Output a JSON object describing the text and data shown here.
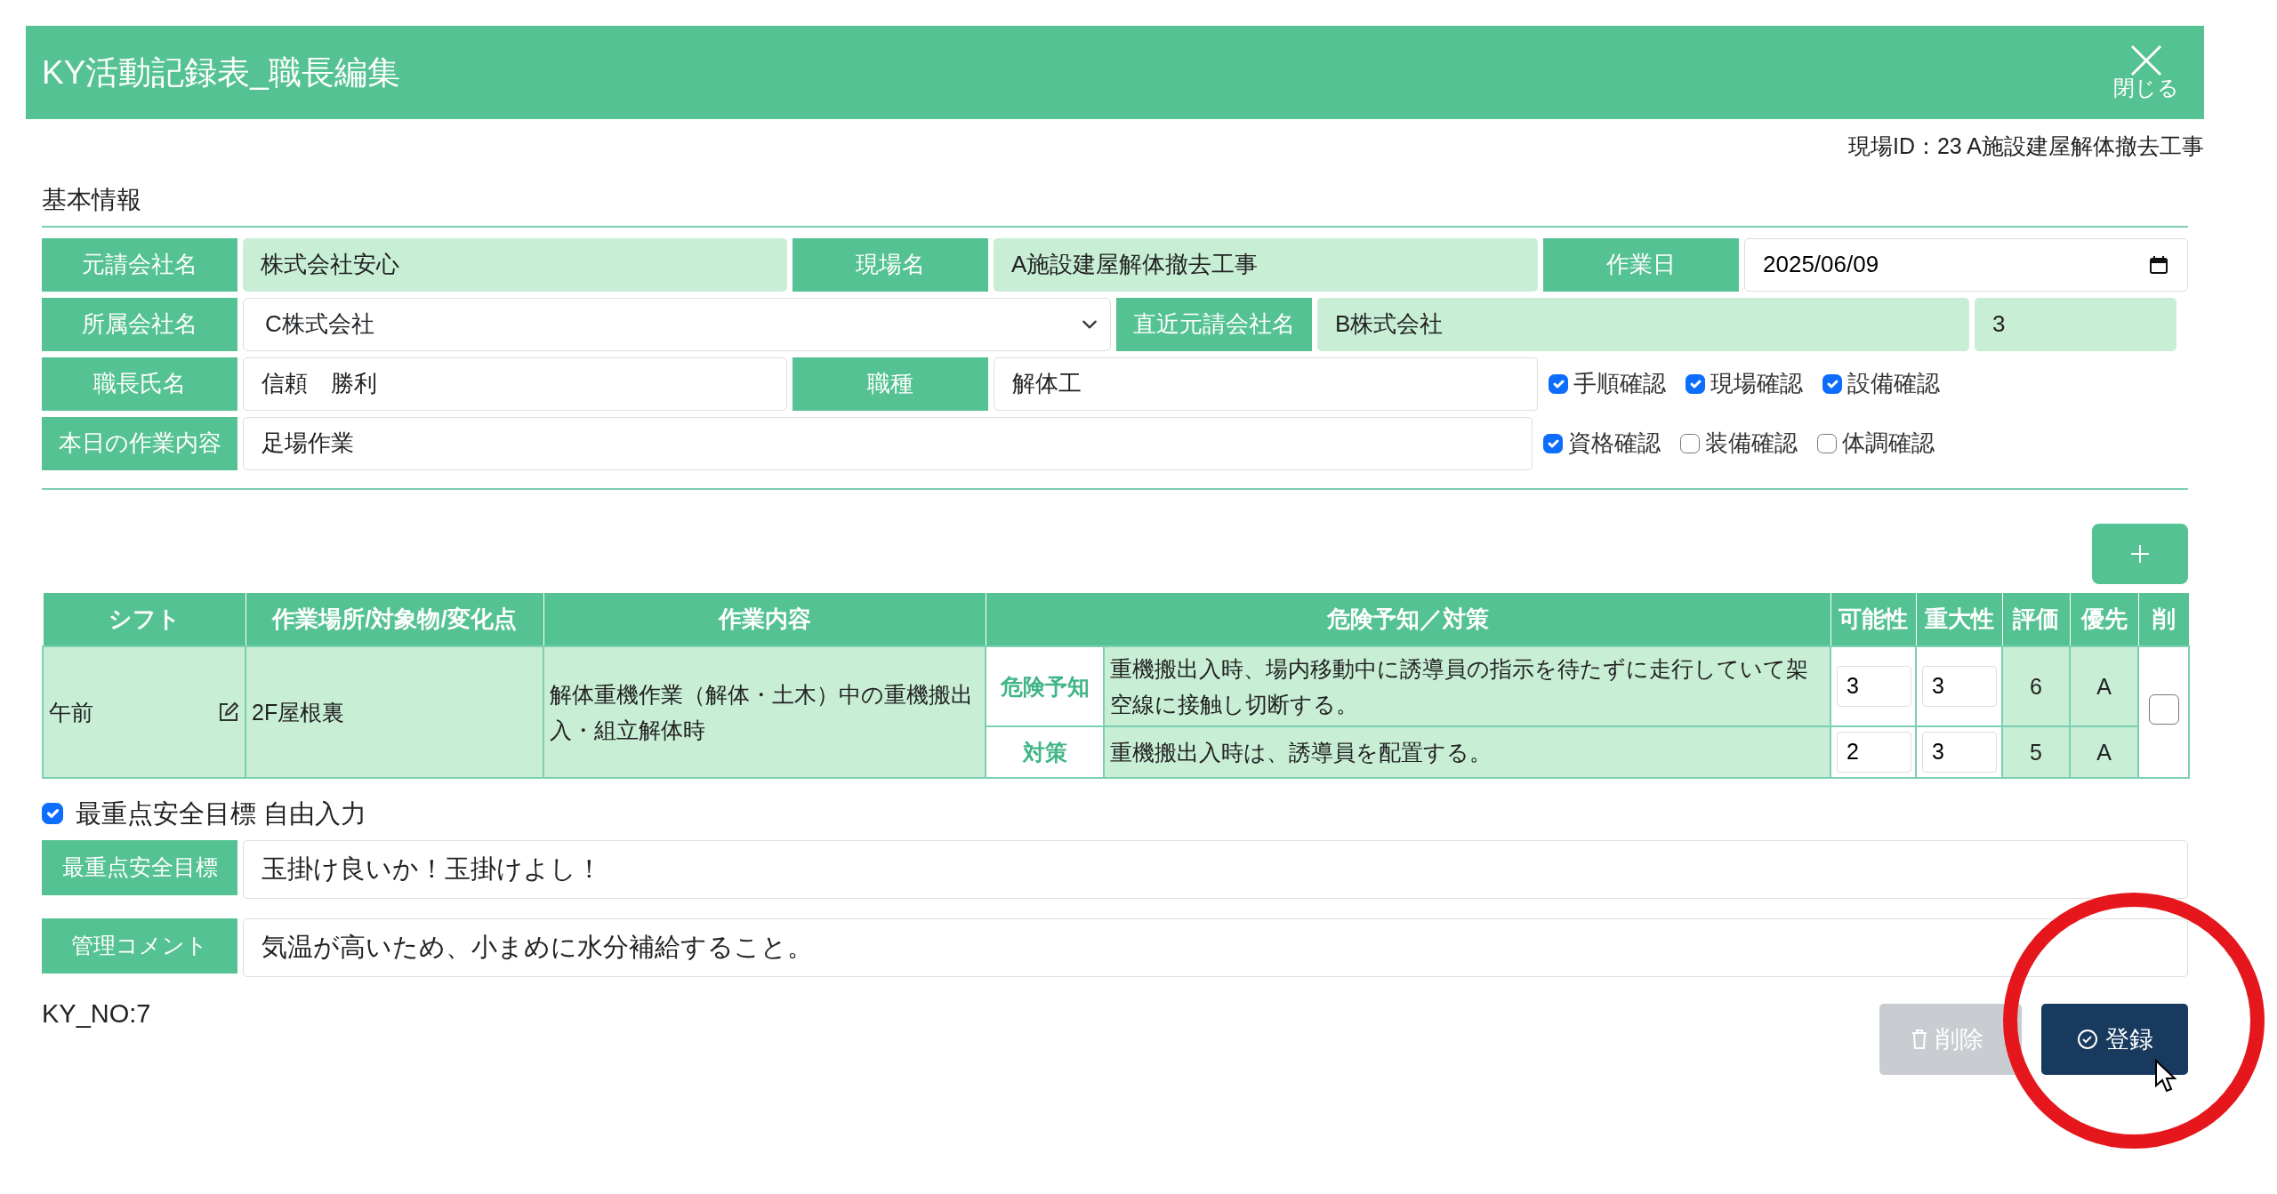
{
  "window": {
    "title": "KY活動記録表_職長編集",
    "close_label": "閉じる"
  },
  "site_id": "現場ID：23 A施設建屋解体撤去工事",
  "section_title": "基本情報",
  "form_rows": [
    [
      {
        "kind": "label",
        "text": "元請会社名"
      },
      {
        "kind": "readonly",
        "value": "株式会社安心"
      },
      {
        "kind": "label",
        "text": "現場名"
      },
      {
        "kind": "readonly",
        "value": "A施設建屋解体撤去工事"
      },
      {
        "kind": "label",
        "text": "作業日"
      },
      {
        "kind": "date",
        "value": "2025/06/09"
      }
    ],
    [
      {
        "kind": "label",
        "text": "所属会社名"
      },
      {
        "kind": "select",
        "value": "C株式会社"
      },
      {
        "kind": "label",
        "text": "直近元請会社名"
      },
      {
        "kind": "readonly",
        "value": "B株式会社"
      },
      {
        "kind": "readonly",
        "value": "3"
      }
    ],
    [
      {
        "kind": "label",
        "text": "職長氏名"
      },
      {
        "kind": "input",
        "value": "信頼　勝利"
      },
      {
        "kind": "label",
        "text": "職種"
      },
      {
        "kind": "input",
        "value": "解体工"
      },
      {
        "kind": "checks",
        "items": [
          {
            "label": "手順確認",
            "checked": true
          },
          {
            "label": "現場確認",
            "checked": true
          },
          {
            "label": "設備確認",
            "checked": true
          }
        ]
      }
    ],
    [
      {
        "kind": "label",
        "text": "本日の作業内容"
      },
      {
        "kind": "input",
        "value": "足場作業"
      },
      {
        "kind": "checks",
        "items": [
          {
            "label": "資格確認",
            "checked": true
          },
          {
            "label": "装備確認",
            "checked": false
          },
          {
            "label": "体調確認",
            "checked": false
          }
        ]
      }
    ]
  ],
  "table": {
    "columns": [
      "シフト",
      "作業場所/対象物/変化点",
      "作業内容",
      "危険予知／対策",
      "可能性",
      "重大性",
      "評価",
      "優先",
      "削"
    ],
    "rows": [
      {
        "shift": "午前",
        "place": "2F屋根裏",
        "work": "解体重機作業（解体・土木）中の重機搬出入・組立解体時",
        "delete_checked": false,
        "items": [
          {
            "tag": "危険予知",
            "text": "重機搬出入時、場内移動中に誘導員の指示を待たずに走行していて架空線に接触し切断する。",
            "likelihood": "3",
            "severity": "3",
            "score": "6",
            "priority": "A"
          },
          {
            "tag": "対策",
            "text": "重機搬出入時は、誘導員を配置する。",
            "likelihood": "2",
            "severity": "3",
            "score": "5",
            "priority": "A"
          }
        ]
      }
    ]
  },
  "goal_toggle": {
    "label": "最重点安全目標 自由入力",
    "checked": true
  },
  "text_fields": [
    {
      "label": "最重点安全目標",
      "value": "玉掛け良いか！玉掛けよし！"
    },
    {
      "label": "管理コメント",
      "value": "気温が高いため、小まめに水分補給すること。"
    }
  ],
  "ky_no": "KY_NO:7",
  "buttons": [
    {
      "kind": "delete",
      "label": "削除",
      "disabled": true
    },
    {
      "kind": "register",
      "label": "登録",
      "disabled": false
    }
  ]
}
